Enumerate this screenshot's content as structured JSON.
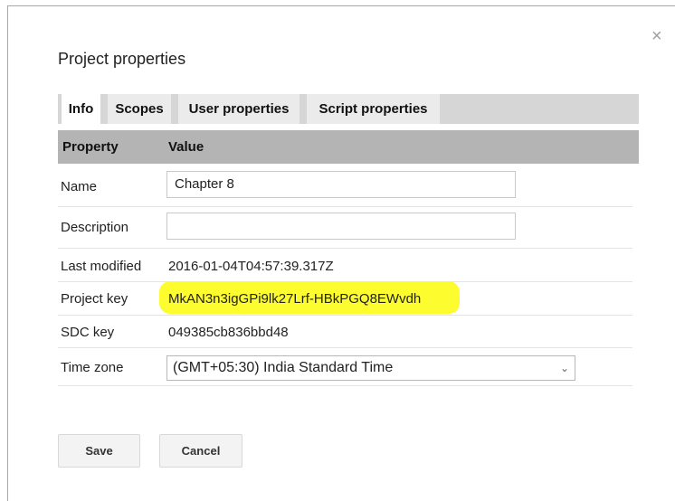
{
  "dialog": {
    "title": "Project properties",
    "close_glyph": "×",
    "close_icon": "close-icon"
  },
  "tabs": [
    {
      "label": "Info",
      "active": true
    },
    {
      "label": "Scopes",
      "active": false
    },
    {
      "label": "User properties",
      "active": false
    },
    {
      "label": "Script properties",
      "active": false
    }
  ],
  "table": {
    "headers": {
      "property": "Property",
      "value": "Value"
    },
    "rows": [
      {
        "label": "Name",
        "value": "Chapter 8",
        "kind": "input"
      },
      {
        "label": "Description",
        "value": "",
        "kind": "input"
      },
      {
        "label": "Last modified",
        "value": "2016-01-04T04:57:39.317Z",
        "kind": "text"
      },
      {
        "label": "Project key",
        "value": "MkAN3n3igGPi9lk27Lrf-HBkPGQ8EWvdh",
        "kind": "text",
        "highlighted": true
      },
      {
        "label": "SDC key",
        "value": "049385cb836bbd48",
        "kind": "text"
      },
      {
        "label": "Time zone",
        "value": "(GMT+05:30) India Standard Time",
        "kind": "select"
      }
    ]
  },
  "buttons": {
    "save": "Save",
    "cancel": "Cancel"
  },
  "colors": {
    "highlight": "#fcfc2e",
    "tabbar": "#d6d6d6",
    "header": "#b4b4b4"
  }
}
